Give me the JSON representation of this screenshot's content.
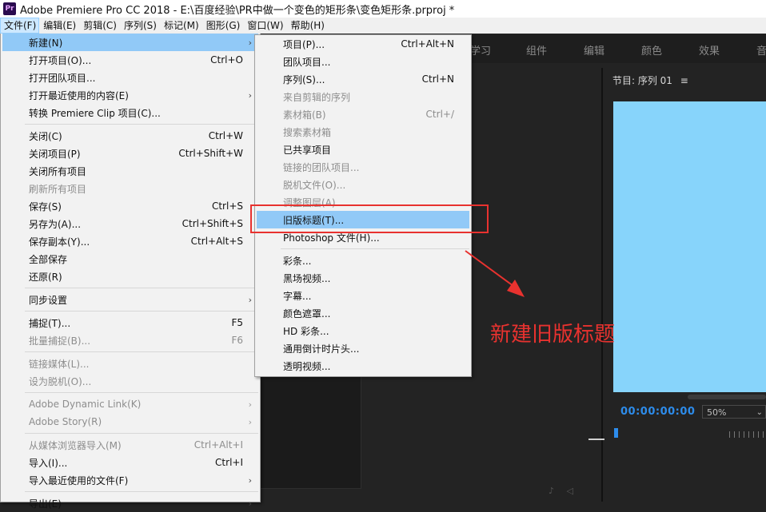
{
  "window": {
    "title": "Adobe Premiere Pro CC 2018 - E:\\百度经验\\PR中做一个变色的矩形条\\变色矩形条.prproj *",
    "logo": "Pr"
  },
  "menubar": [
    "文件(F)",
    "编辑(E)",
    "剪辑(C)",
    "序列(S)",
    "标记(M)",
    "图形(G)",
    "窗口(W)",
    "帮助(H)"
  ],
  "workspace_tabs": [
    "学习",
    "组件",
    "编辑",
    "颜色",
    "效果",
    "音"
  ],
  "program_monitor": {
    "header": "节目: 序列 01",
    "timecode": "00:00:00:00",
    "zoom": "50%",
    "frame_color": "#87d4fb"
  },
  "file_menu": [
    {
      "label": "新建(N)",
      "shortcut": "",
      "arrow": true,
      "disabled": false,
      "highlight": true
    },
    {
      "label": "打开项目(O)...",
      "shortcut": "Ctrl+O",
      "arrow": false,
      "disabled": false
    },
    {
      "label": "打开团队项目...",
      "shortcut": "",
      "arrow": false,
      "disabled": false
    },
    {
      "label": "打开最近使用的内容(E)",
      "shortcut": "",
      "arrow": true,
      "disabled": false
    },
    {
      "label": "转换 Premiere Clip 项目(C)...",
      "shortcut": "",
      "arrow": false,
      "disabled": false
    },
    {
      "sep": true
    },
    {
      "label": "关闭(C)",
      "shortcut": "Ctrl+W",
      "arrow": false,
      "disabled": false
    },
    {
      "label": "关闭项目(P)",
      "shortcut": "Ctrl+Shift+W",
      "arrow": false,
      "disabled": false
    },
    {
      "label": "关闭所有项目",
      "shortcut": "",
      "arrow": false,
      "disabled": false
    },
    {
      "label": "刷新所有项目",
      "shortcut": "",
      "arrow": false,
      "disabled": true
    },
    {
      "label": "保存(S)",
      "shortcut": "Ctrl+S",
      "arrow": false,
      "disabled": false
    },
    {
      "label": "另存为(A)...",
      "shortcut": "Ctrl+Shift+S",
      "arrow": false,
      "disabled": false
    },
    {
      "label": "保存副本(Y)...",
      "shortcut": "Ctrl+Alt+S",
      "arrow": false,
      "disabled": false
    },
    {
      "label": "全部保存",
      "shortcut": "",
      "arrow": false,
      "disabled": false
    },
    {
      "label": "还原(R)",
      "shortcut": "",
      "arrow": false,
      "disabled": false
    },
    {
      "sep": true
    },
    {
      "label": "同步设置",
      "shortcut": "",
      "arrow": true,
      "disabled": false
    },
    {
      "sep": true
    },
    {
      "label": "捕捉(T)...",
      "shortcut": "F5",
      "arrow": false,
      "disabled": false
    },
    {
      "label": "批量捕捉(B)...",
      "shortcut": "F6",
      "arrow": false,
      "disabled": true
    },
    {
      "sep": true
    },
    {
      "label": "链接媒体(L)...",
      "shortcut": "",
      "arrow": false,
      "disabled": true
    },
    {
      "label": "设为脱机(O)...",
      "shortcut": "",
      "arrow": false,
      "disabled": true
    },
    {
      "sep": true
    },
    {
      "label": "Adobe Dynamic Link(K)",
      "shortcut": "",
      "arrow": true,
      "disabled": true
    },
    {
      "label": "Adobe Story(R)",
      "shortcut": "",
      "arrow": true,
      "disabled": true
    },
    {
      "sep": true
    },
    {
      "label": "从媒体浏览器导入(M)",
      "shortcut": "Ctrl+Alt+I",
      "arrow": false,
      "disabled": true
    },
    {
      "label": "导入(I)...",
      "shortcut": "Ctrl+I",
      "arrow": false,
      "disabled": false
    },
    {
      "label": "导入最近使用的文件(F)",
      "shortcut": "",
      "arrow": true,
      "disabled": false
    },
    {
      "sep": true
    },
    {
      "label": "导出(E)",
      "shortcut": "",
      "arrow": true,
      "disabled": false
    }
  ],
  "new_submenu": [
    {
      "label": "项目(P)...",
      "shortcut": "Ctrl+Alt+N",
      "disabled": false
    },
    {
      "label": "团队项目...",
      "shortcut": "",
      "disabled": false
    },
    {
      "label": "序列(S)...",
      "shortcut": "Ctrl+N",
      "disabled": false
    },
    {
      "label": "来自剪辑的序列",
      "shortcut": "",
      "disabled": true
    },
    {
      "label": "素材箱(B)",
      "shortcut": "Ctrl+/",
      "disabled": true
    },
    {
      "label": "搜索素材箱",
      "shortcut": "",
      "disabled": true
    },
    {
      "label": "已共享项目",
      "shortcut": "",
      "disabled": false
    },
    {
      "label": "链接的团队项目...",
      "shortcut": "",
      "disabled": true
    },
    {
      "label": "脱机文件(O)...",
      "shortcut": "",
      "disabled": true
    },
    {
      "label": "调整图层(A)...",
      "shortcut": "",
      "disabled": true
    },
    {
      "label": "旧版标题(T)...",
      "shortcut": "",
      "disabled": false,
      "highlight": true
    },
    {
      "label": "Photoshop 文件(H)...",
      "shortcut": "",
      "disabled": false
    },
    {
      "sep": true
    },
    {
      "label": "彩条...",
      "shortcut": "",
      "disabled": false
    },
    {
      "label": "黑场视频...",
      "shortcut": "",
      "disabled": false
    },
    {
      "label": "字幕...",
      "shortcut": "",
      "disabled": false
    },
    {
      "label": "颜色遮罩...",
      "shortcut": "",
      "disabled": false
    },
    {
      "label": "HD 彩条...",
      "shortcut": "",
      "disabled": false
    },
    {
      "label": "通用倒计时片头...",
      "shortcut": "",
      "disabled": false
    },
    {
      "label": "透明视频...",
      "shortcut": "",
      "disabled": false
    }
  ],
  "annotation": {
    "text": "新建旧版标题",
    "color": "#e8322f"
  }
}
